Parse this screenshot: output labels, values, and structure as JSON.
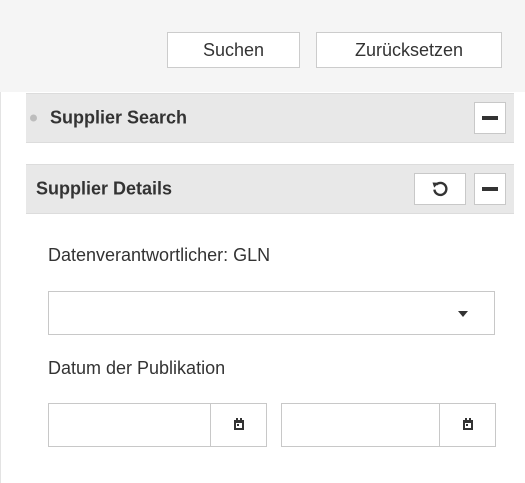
{
  "toolbar": {
    "search_label": "Suchen",
    "reset_label": "Zurücksetzen"
  },
  "panels": {
    "supplier_search": {
      "title": "Supplier Search",
      "collapse_icon": "minus-icon",
      "expanded": false
    },
    "supplier_details": {
      "title": "Supplier Details",
      "refresh_icon": "refresh-icon",
      "collapse_icon": "minus-icon",
      "expanded": true
    }
  },
  "form": {
    "gln": {
      "label": "Datenverantwortlicher: GLN",
      "selected_value": ""
    },
    "publication_date": {
      "label": "Datum der Publikation",
      "from_value": "",
      "to_value": "",
      "calendar_icon": "calendar-icon"
    }
  }
}
